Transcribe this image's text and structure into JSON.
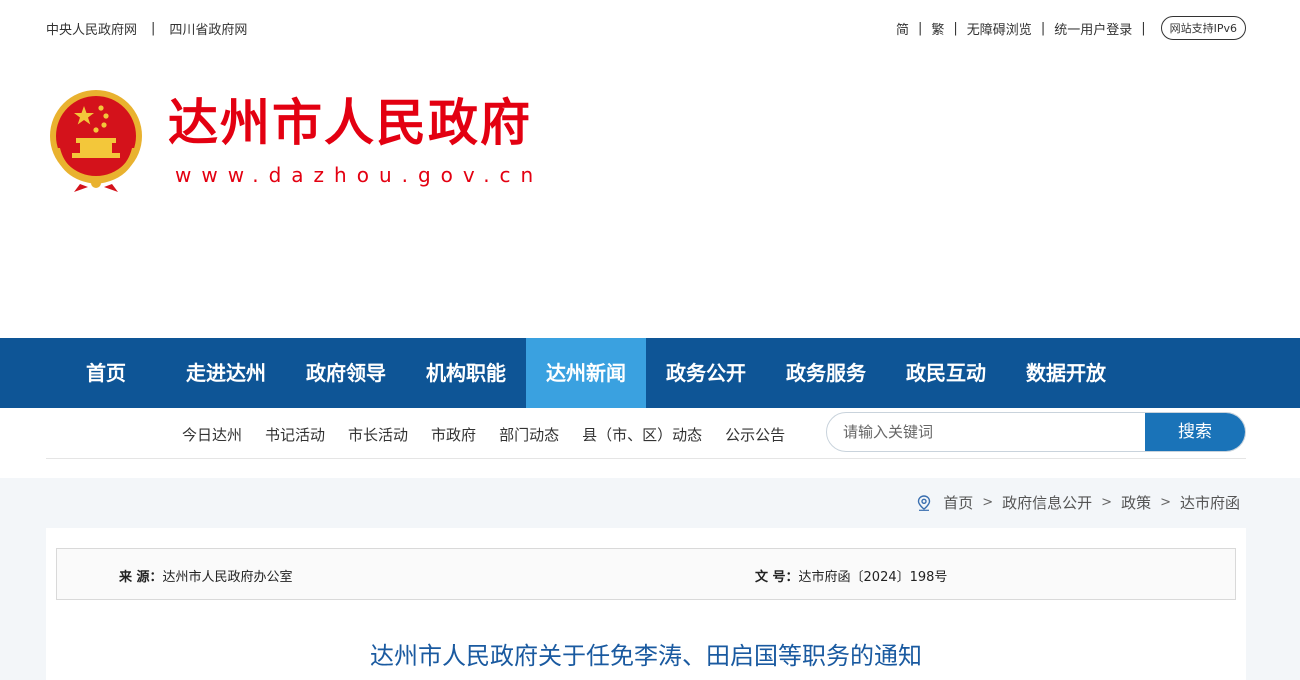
{
  "topbar": {
    "left_links": [
      "中央人民政府网",
      "四川省政府网"
    ],
    "right_links": [
      "简",
      "繁",
      "无障碍浏览",
      "统一用户登录"
    ],
    "ipv6_badge": "网站支持IPv6",
    "separator": "|"
  },
  "header": {
    "title": "达州市人民政府",
    "url": "www.dazhou.gov.cn"
  },
  "nav": {
    "items": [
      {
        "label": "首页"
      },
      {
        "label": "走进达州"
      },
      {
        "label": "政府领导"
      },
      {
        "label": "机构职能"
      },
      {
        "label": "达州新闻"
      },
      {
        "label": "政务公开"
      },
      {
        "label": "政务服务"
      },
      {
        "label": "政民互动"
      },
      {
        "label": "数据开放"
      }
    ],
    "active": "达州新闻"
  },
  "subnav": {
    "items": [
      "今日达州",
      "书记活动",
      "市长活动",
      "市政府",
      "部门动态",
      "县（市、区）动态",
      "公示公告"
    ]
  },
  "search": {
    "placeholder": "请输入关键词",
    "button": "搜索"
  },
  "breadcrumb": {
    "items": [
      "首页",
      "政府信息公开",
      "政策",
      "达市府函"
    ],
    "separator": ">"
  },
  "article": {
    "source_label": "来  源：",
    "source_value": "达州市人民政府办公室",
    "docno_label": "文  号：",
    "docno_value": "达市府函〔2024〕198号",
    "title": "达州市人民政府关于任免李涛、田启国等职务的通知"
  },
  "colors": {
    "brand_red": "#e30011",
    "nav_blue": "#0e5596",
    "nav_active": "#3aa1e0",
    "search_button": "#1a73b8",
    "title_blue": "#1a5aa0"
  }
}
